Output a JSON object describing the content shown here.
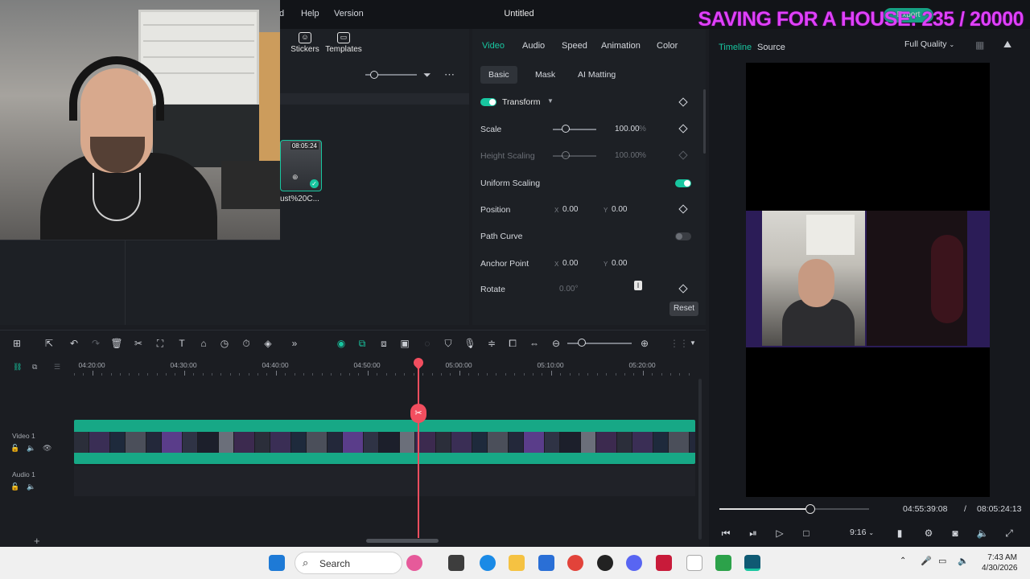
{
  "window": {
    "menu": [
      "d",
      "Help",
      "Version"
    ],
    "title": "Untitled",
    "overlay_text": "SAVING FOR A HOUSE: 235 / 20000",
    "export_label": "Export"
  },
  "media": {
    "tools": [
      {
        "label": "Stickers",
        "icon": "sticker-icon"
      },
      {
        "label": "Templates",
        "icon": "template-icon"
      }
    ],
    "clip": {
      "duration": "08:05:24",
      "name": "ust%20C..."
    }
  },
  "properties": {
    "tabs": [
      "Video",
      "Audio",
      "Speed",
      "Animation",
      "Color"
    ],
    "active_tab": "Video",
    "subtabs": [
      "Basic",
      "Mask",
      "AI Matting"
    ],
    "active_subtab": "Basic",
    "section": "Transform",
    "scale": {
      "label": "Scale",
      "value": "100.00",
      "unit": "%"
    },
    "height_scaling": {
      "label": "Height Scaling",
      "value": "100.00",
      "unit": "%"
    },
    "uniform_scaling": {
      "label": "Uniform Scaling",
      "on": true
    },
    "position": {
      "label": "Position",
      "x_axis": "X",
      "y_axis": "Y",
      "x": "0.00",
      "y": "0.00"
    },
    "path_curve": {
      "label": "Path Curve",
      "on": false
    },
    "anchor_point": {
      "label": "Anchor Point",
      "x_axis": "X",
      "y_axis": "Y",
      "x": "0.00",
      "y": "0.00"
    },
    "rotate": {
      "label": "Rotate",
      "value": "0.00°"
    },
    "reset_label": "Reset"
  },
  "preview": {
    "tabs": [
      "Timeline",
      "Source"
    ],
    "active_tab": "Timeline",
    "quality": "Full Quality",
    "current_time": "04:55:39:08",
    "separator": "/",
    "total_time": "08:05:24:13",
    "aspect": "9:16",
    "progress": 0.61
  },
  "timeline": {
    "ruler": [
      "04:20:00",
      "04:30:00",
      "04:40:00",
      "04:50:00",
      "05:00:00",
      "05:10:00",
      "05:20:00"
    ],
    "tracks": [
      {
        "label": "Video 1"
      },
      {
        "label": "Audio 1"
      }
    ]
  },
  "taskbar": {
    "search_placeholder": "Search",
    "time": "7:43 AM",
    "date": "4/30/2026"
  },
  "colors": {
    "accent": "#18c6a0",
    "playhead": "#f24e5f",
    "overlay": "#e040fb"
  }
}
